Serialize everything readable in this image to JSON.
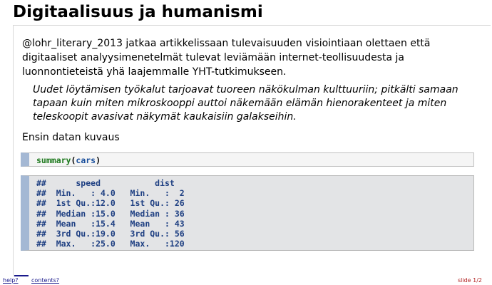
{
  "slide": {
    "title": "Digitaalisuus ja humanismi",
    "intro": "@lohr_literary_2013 jatkaa artikkelissaan tulevaisuuden visiointiaan olettaen että digitaaliset analyysimenetelmät tulevat leviämään internet-teollisuudesta ja luonnontieteistä yhä laajemmalle YHT-tutkimukseen.",
    "quote": "Uudet löytämisen työkalut tarjoavat tuoreen näkökulman kulttuuriin; pitkälti samaan tapaan kuin miten mikroskooppi auttoi näkemään elämän hienorakenteet ja miten teleskoopit avasivat näkymät kaukaisiin galakseihin.",
    "lead": "Ensin datan kuvaus"
  },
  "code": {
    "function": "summary",
    "open_paren": "(",
    "argument": "cars",
    "close_paren": ")"
  },
  "output": {
    "lines": [
      "##      speed           dist       ",
      "##  Min.   : 4.0   Min.   :  2  ",
      "##  1st Qu.:12.0   1st Qu.: 26  ",
      "##  Median :15.0   Median : 36  ",
      "##  Mean   :15.4   Mean   : 43  ",
      "##  3rd Qu.:19.0   3rd Qu.: 56  ",
      "##  Max.   :25.0   Max.   :120  "
    ]
  },
  "footer": {
    "help_label": "help?",
    "contents_label": "contents?",
    "slide_counter": "slide 1/2"
  }
}
